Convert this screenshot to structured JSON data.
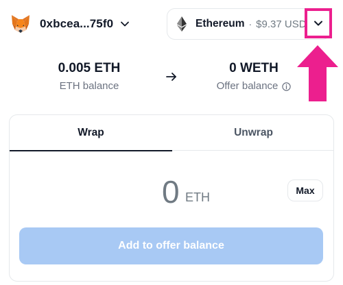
{
  "header": {
    "wallet_address": "0xbcea...75f0",
    "wallet_icon": "metamask-fox-icon",
    "network": {
      "name": "Ethereum",
      "separator": "·",
      "usd_value": "$9.37 USD",
      "icon": "ethereum-icon"
    }
  },
  "balances": {
    "left": {
      "value": "0.005 ETH",
      "label": "ETH balance"
    },
    "right": {
      "value": "0 WETH",
      "label": "Offer balance"
    }
  },
  "card": {
    "tabs": [
      {
        "label": "Wrap",
        "active": true
      },
      {
        "label": "Unwrap",
        "active": false
      }
    ],
    "amount": {
      "value": "0",
      "unit": "ETH"
    },
    "max_label": "Max",
    "submit_label": "Add to offer balance"
  },
  "colors": {
    "highlight": "#ec1f8e",
    "submit_disabled": "#a8c9f4",
    "text_primary": "#111827",
    "text_muted": "#707a83"
  }
}
